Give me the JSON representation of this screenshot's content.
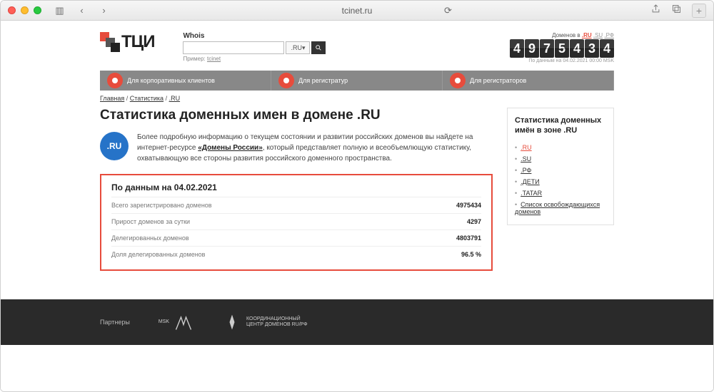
{
  "browser": {
    "url": "tcinet.ru",
    "newtab": "+"
  },
  "header": {
    "logo_text": "ТЦИ",
    "whois": {
      "label": "Whois",
      "tld": ".RU",
      "example_prefix": "Пример: ",
      "example_link": "tcinet"
    },
    "counter": {
      "label_prefix": "Доменов в ",
      "zones": [
        ".RU",
        ".SU",
        ".РФ"
      ],
      "digits": [
        "4",
        "9",
        "7",
        "5",
        "4",
        "3",
        "4"
      ],
      "date": "По данным на 04.02.2021 00:00 MSK"
    }
  },
  "nav": [
    "Для корпоративных клиентов",
    "Для регистратур",
    "Для регистраторов"
  ],
  "breadcrumb": [
    "Главная",
    "Статистика",
    ".RU"
  ],
  "page": {
    "title": "Статистика доменных имен в домене .RU",
    "badge": ".RU",
    "intro_1": "Более подробную информацию о текущем состоянии и развитии российских доменов вы найдете на интернет-ресурсе ",
    "intro_link": "«Домены России»",
    "intro_2": ", который представляет полную и всеобъемлющую статистику, охватывающую все стороны развития российского доменного пространства."
  },
  "stats": {
    "title": "По данным на 04.02.2021",
    "rows": [
      {
        "label": "Всего зарегистрировано доменов",
        "value": "4975434"
      },
      {
        "label": "Прирост доменов за сутки",
        "value": "4297"
      },
      {
        "label": "Делегированных доменов",
        "value": "4803791"
      },
      {
        "label": "Доля делегированных доменов",
        "value": "96.5 %"
      }
    ]
  },
  "sidebar": {
    "title": "Статистика доменных имён в зоне .RU",
    "items": [
      ".RU",
      ".SU",
      ".РФ",
      ".ДЕТИ",
      ".TATAR",
      "Список освобождающихся доменов"
    ]
  },
  "footer": {
    "partners": "Партнеры",
    "p1_top": "MSK",
    "p1_main": "IX",
    "p2": "КООРДИНАЦИОННЫЙ ЦЕНТР ДОМЕНОВ RU/РФ"
  }
}
